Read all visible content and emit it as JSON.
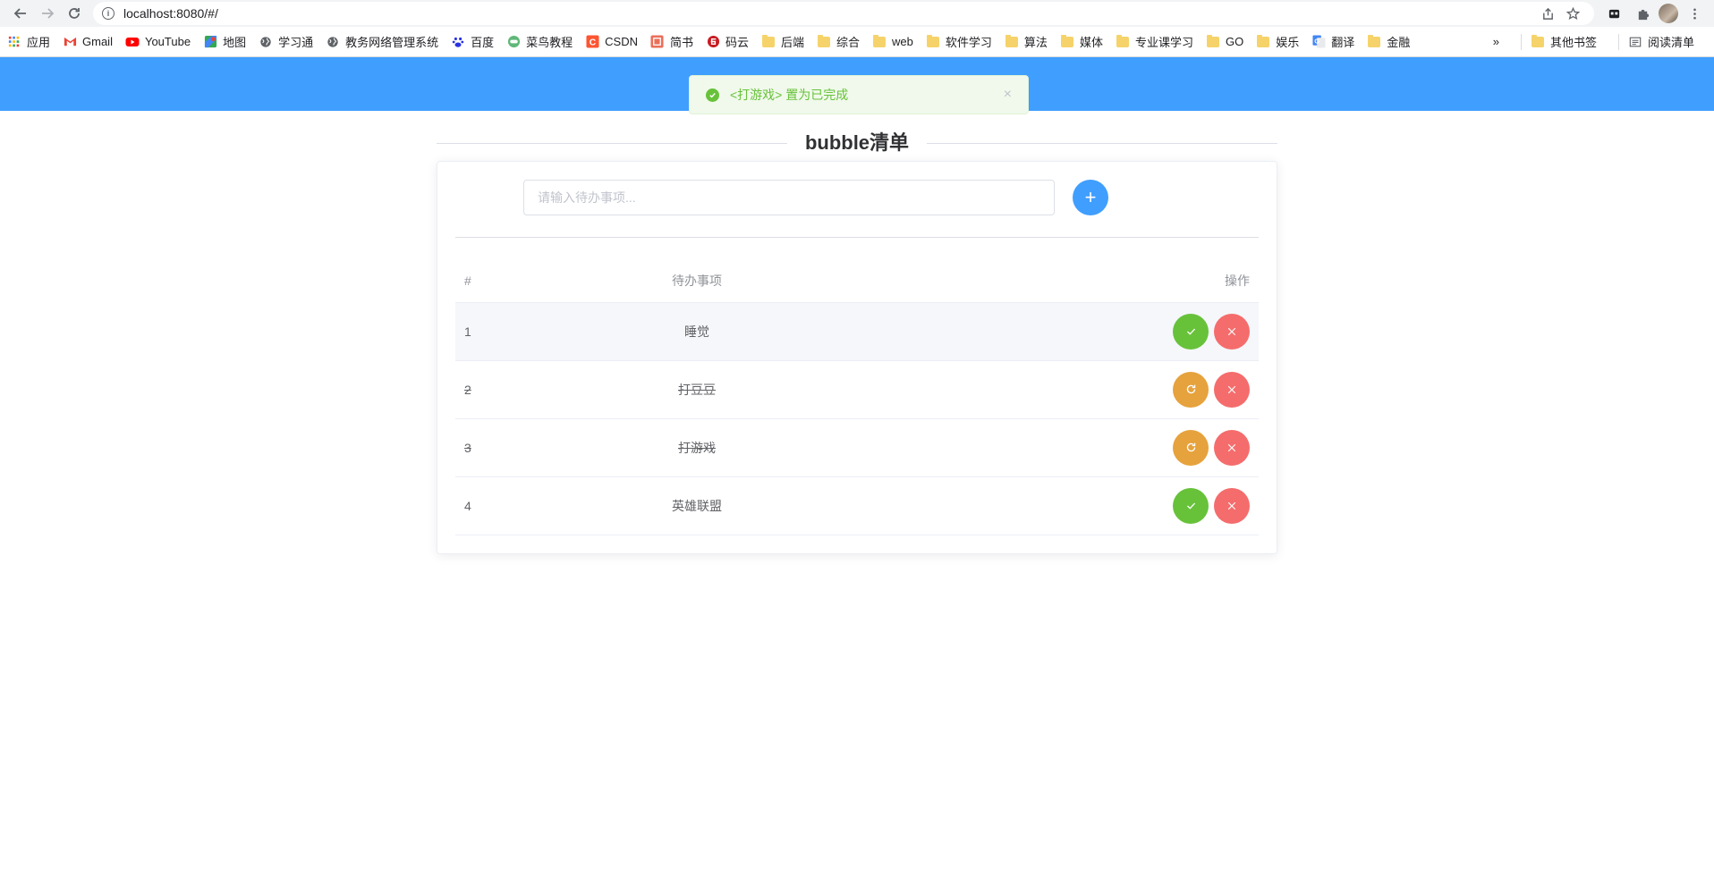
{
  "browser": {
    "url": "localhost:8080/#/",
    "bookmarks": [
      {
        "label": "应用",
        "icon": "apps-grid-icon"
      },
      {
        "label": "Gmail",
        "icon": "gmail-icon"
      },
      {
        "label": "YouTube",
        "icon": "youtube-icon"
      },
      {
        "label": "地图",
        "icon": "maps-icon"
      },
      {
        "label": "学习通",
        "icon": "globe-icon"
      },
      {
        "label": "教务网络管理系统",
        "icon": "globe-icon"
      },
      {
        "label": "百度",
        "icon": "baidu-icon"
      },
      {
        "label": "菜鸟教程",
        "icon": "runoob-icon"
      },
      {
        "label": "CSDN",
        "icon": "csdn-icon"
      },
      {
        "label": "简书",
        "icon": "jianshu-icon"
      },
      {
        "label": "码云",
        "icon": "gitee-icon"
      },
      {
        "label": "后端",
        "icon": "folder-icon"
      },
      {
        "label": "综合",
        "icon": "folder-icon"
      },
      {
        "label": "web",
        "icon": "folder-icon"
      },
      {
        "label": "软件学习",
        "icon": "folder-icon"
      },
      {
        "label": "算法",
        "icon": "folder-icon"
      },
      {
        "label": "媒体",
        "icon": "folder-icon"
      },
      {
        "label": "专业课学习",
        "icon": "folder-icon"
      },
      {
        "label": "GO",
        "icon": "folder-icon"
      },
      {
        "label": "娱乐",
        "icon": "folder-icon"
      },
      {
        "label": "翻译",
        "icon": "translate-icon"
      },
      {
        "label": "金融",
        "icon": "folder-icon"
      }
    ],
    "overflow_label": "»",
    "other_bookmarks": "其他书签",
    "reading_list": "阅读清单"
  },
  "colors": {
    "primary": "#409eff",
    "success": "#67c23a",
    "warning": "#e6a23c",
    "danger": "#f56c6c"
  },
  "toast": {
    "message": "<打游戏> 置为已完成",
    "close": "×"
  },
  "app": {
    "title": "bubble清单",
    "input_placeholder": "请输入待办事项...",
    "add_label": "+"
  },
  "table": {
    "headers": {
      "index": "#",
      "name": "待办事项",
      "ops": "操作"
    },
    "rows": [
      {
        "index": "1",
        "name": "睡觉",
        "done": false
      },
      {
        "index": "2",
        "name": "打豆豆",
        "done": true
      },
      {
        "index": "3",
        "name": "打游戏",
        "done": true
      },
      {
        "index": "4",
        "name": "英雄联盟",
        "done": false
      }
    ]
  }
}
